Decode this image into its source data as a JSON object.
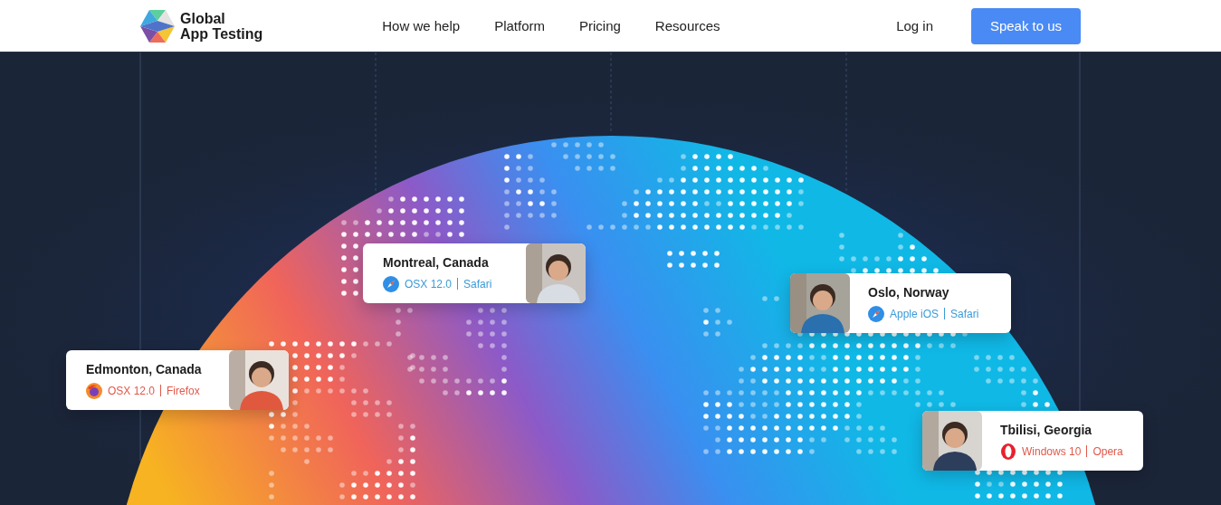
{
  "header": {
    "logo": {
      "line_1": "Global",
      "line_2": "App Testing"
    },
    "nav": [
      "How we help",
      "Platform",
      "Pricing",
      "Resources"
    ],
    "login": "Log in",
    "cta": "Speak to us"
  },
  "testers": [
    {
      "city": "Montreal, Canada",
      "os": "OSX 12.0",
      "browser": "Safari",
      "kind": "safari",
      "color": "#3a9bd8"
    },
    {
      "city": "Edmonton, Canada",
      "os": "OSX 12.0",
      "browser": "Firefox",
      "kind": "firefox",
      "color": "#e0584a"
    },
    {
      "city": "Oslo, Norway",
      "os": "Apple iOS",
      "browser": "Safari",
      "kind": "safari",
      "color": "#3a9bd8"
    },
    {
      "city": "Tbilisi, Georgia",
      "os": "Windows 10",
      "browser": "Opera",
      "kind": "opera",
      "color": "#e0584a"
    }
  ]
}
